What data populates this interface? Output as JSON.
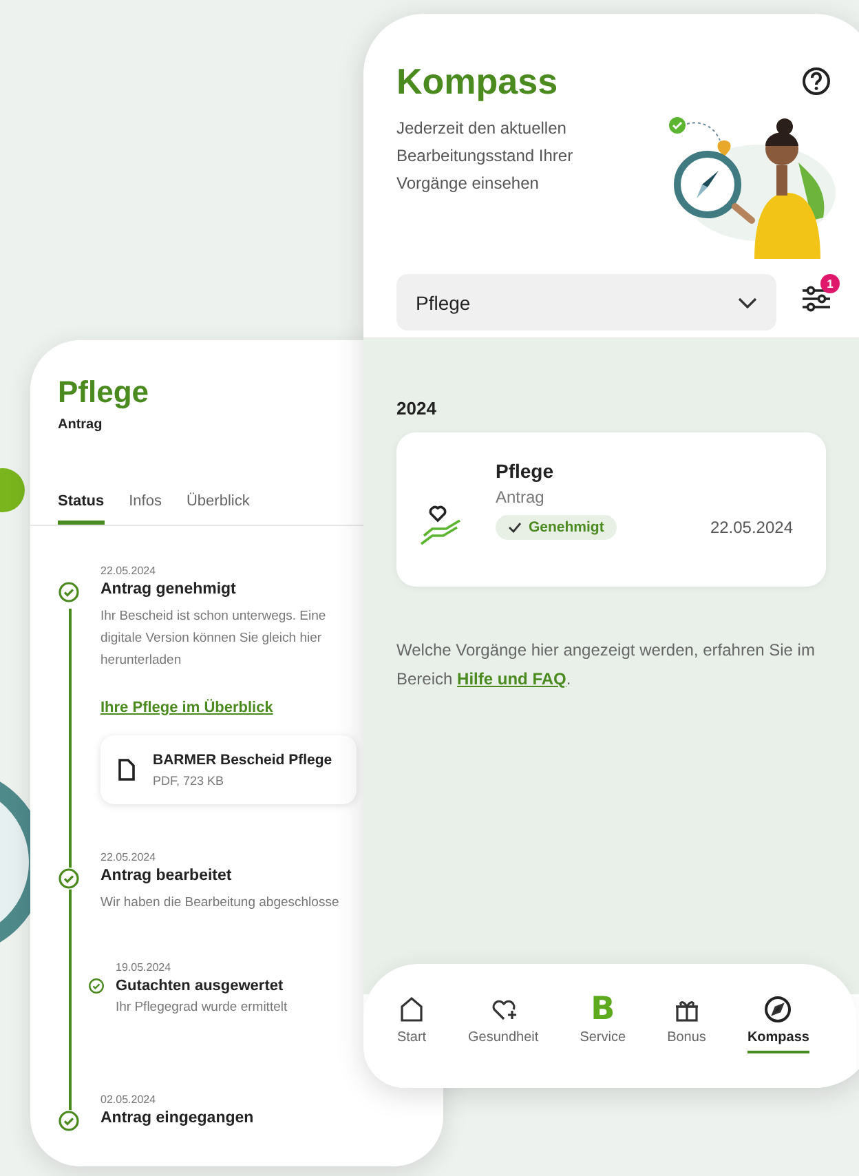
{
  "left_phone": {
    "title": "Pflege",
    "subtitle": "Antrag",
    "tabs": [
      {
        "label": "Status",
        "selected": true
      },
      {
        "label": "Infos",
        "selected": false
      },
      {
        "label": "Überblick",
        "selected": false
      }
    ],
    "timeline": [
      {
        "kind": "main",
        "done": true,
        "date": "22.05.2024",
        "title": "Antrag genehmigt",
        "text": "Ihr Bescheid ist schon unterwegs. Eine digitale Version können Sie gleich hier herunterladen",
        "link": "Ihre Pflege im Überblick",
        "document": {
          "name": "BARMER Bescheid Pflege",
          "meta": "PDF, 723 KB"
        }
      },
      {
        "kind": "main",
        "done": true,
        "date": "22.05.2024",
        "title": "Antrag bearbeitet",
        "text": "Wir haben die Bearbeitung abgeschlosse"
      },
      {
        "kind": "sub",
        "done": true,
        "date": "19.05.2024",
        "title": "Gutachten ausgewertet",
        "text": "Ihr Pflegegrad wurde ermittelt"
      },
      {
        "kind": "main",
        "done": true,
        "date": "02.05.2024",
        "title": "Antrag eingegangen"
      }
    ]
  },
  "right_phone": {
    "title": "Kompass",
    "description": "Jederzeit den aktuellen Bearbeitungsstand Ihrer Vorgänge einsehen",
    "filter_select": {
      "value": "Pflege"
    },
    "filter_badge": "1",
    "year": "2024",
    "cards": [
      {
        "title": "Pflege",
        "subtitle": "Antrag",
        "status": "Genehmigt",
        "date": "22.05.2024"
      }
    ],
    "info_text": "Welche Vorgänge hier angezeigt werden, erfahren Sie im Bereich ",
    "info_link": "Hilfe und FAQ",
    "info_end": ".",
    "nav": [
      {
        "kind": "home",
        "label": "Start",
        "selected": false
      },
      {
        "kind": "health",
        "label": "Gesundheit",
        "selected": false
      },
      {
        "kind": "brand",
        "logo": "B",
        "label": "Service",
        "selected": false
      },
      {
        "kind": "gift",
        "label": "Bonus",
        "selected": false
      },
      {
        "kind": "compass",
        "label": "Kompass",
        "selected": true
      }
    ]
  }
}
